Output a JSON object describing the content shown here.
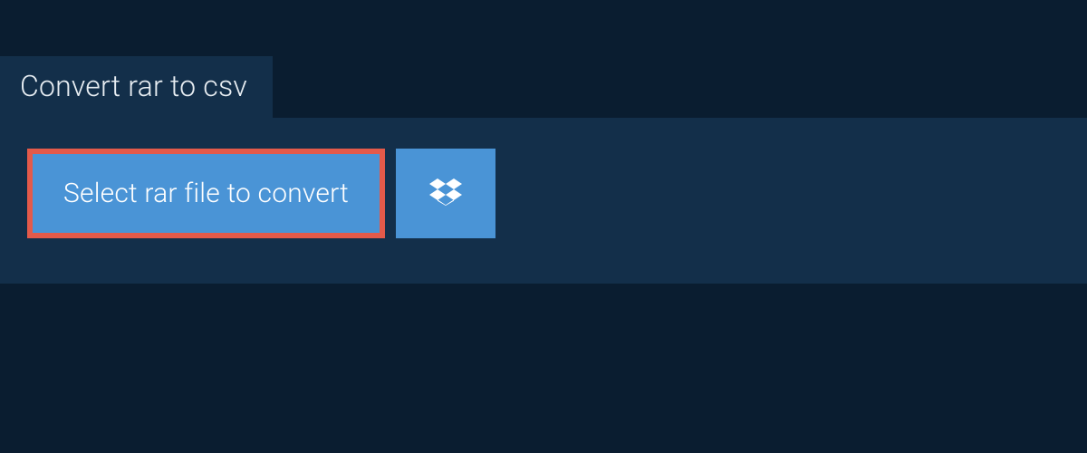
{
  "tab": {
    "title": "Convert rar to csv"
  },
  "actions": {
    "select_file_label": "Select rar file to convert"
  }
}
